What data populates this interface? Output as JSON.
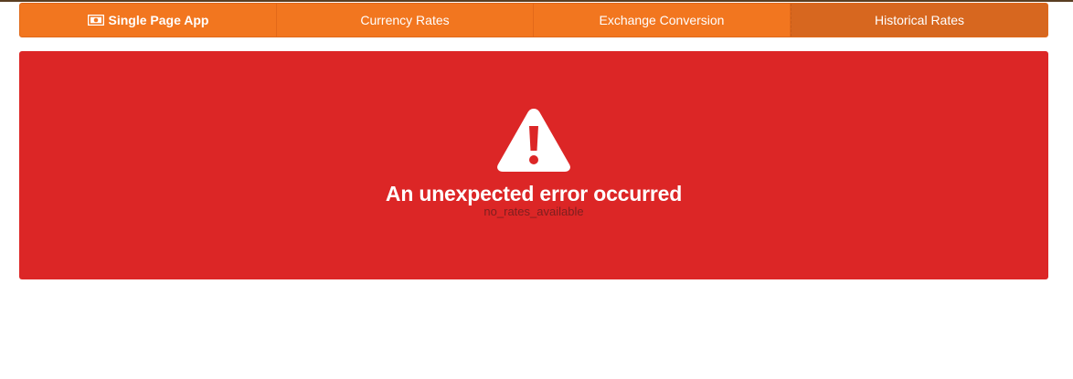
{
  "nav": {
    "brand_label": "Single Page App",
    "brand_icon": "money-bill-icon",
    "items": [
      {
        "label": "Currency Rates",
        "active": false
      },
      {
        "label": "Exchange Conversion",
        "active": false
      },
      {
        "label": "Historical Rates",
        "active": true
      }
    ]
  },
  "error": {
    "icon": "warning-triangle-icon",
    "title": "An unexpected error occurred",
    "detail": "no_rates_available"
  },
  "colors": {
    "nav_bg": "#f2761f",
    "nav_active_bg": "#d7671f",
    "error_bg": "#dc2626",
    "text": "#ffffff"
  }
}
